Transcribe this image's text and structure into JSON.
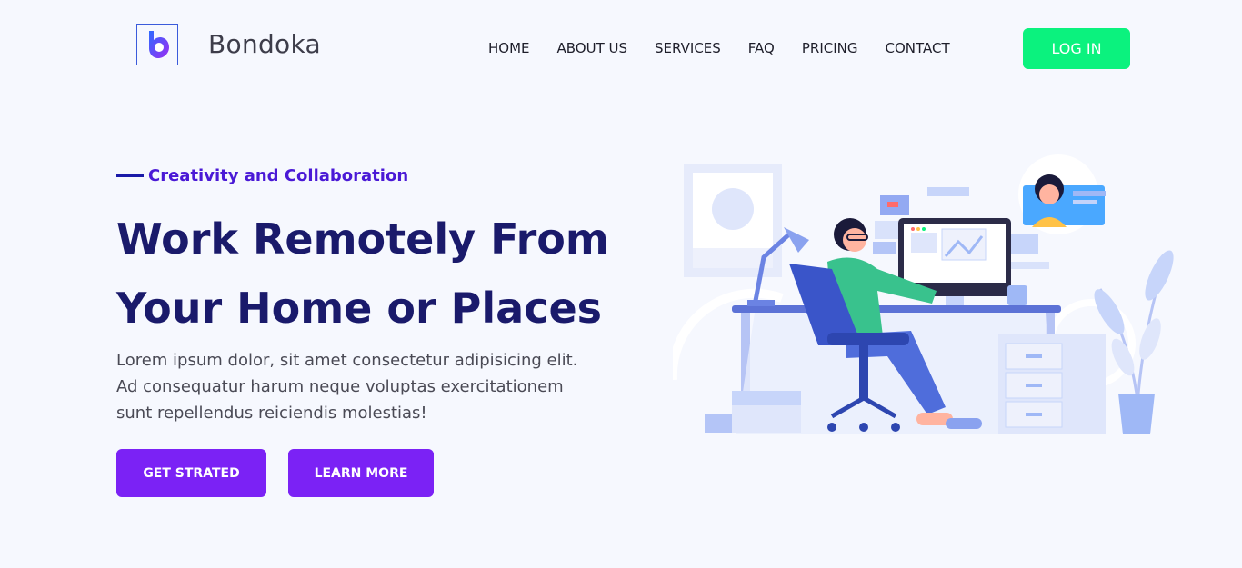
{
  "header": {
    "brand": "Bondoka",
    "logo_icon": "bondoka-logo-icon",
    "nav": [
      "HOME",
      "ABOUT US",
      "SERVICES",
      "FAQ",
      "PRICING",
      "CONTACT"
    ],
    "login_label": "LOG IN"
  },
  "hero": {
    "eyebrow": "Creativity and Collaboration",
    "headline_line1": "Work Remotely From",
    "headline_line2": "Your Home or Places",
    "lead_line1": "Lorem ipsum dolor, sit amet consectetur adipisicing elit.",
    "lead_line2": "Ad consequatur harum neque voluptas exercitationem",
    "lead_line3": "sunt repellendus reiciendis molestias!",
    "primary_button": "GET STRATED",
    "secondary_button": "LEARN MORE",
    "illustration": "remote-work-illustration"
  },
  "colors": {
    "background": "#f6f8fe",
    "login_button": "#0bf27e",
    "cta_button": "#7b22f5",
    "headline": "#1a1a6b",
    "eyebrow": "#4a19d6"
  }
}
